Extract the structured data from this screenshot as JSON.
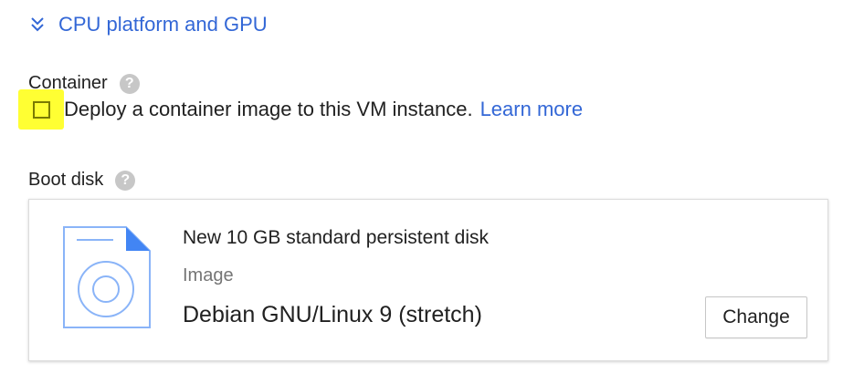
{
  "expander": {
    "label": "CPU platform and GPU",
    "icon": "double-chevron-down-icon"
  },
  "container": {
    "label": "Container",
    "help_icon": "?",
    "checkbox_checked": false,
    "checkbox_text": "Deploy a container image to this VM instance.",
    "learn_more": "Learn more"
  },
  "boot_disk": {
    "label": "Boot disk",
    "help_icon": "?",
    "title": "New 10 GB standard persistent disk",
    "image_label": "Image",
    "image_value": "Debian GNU/Linux 9 (stretch)",
    "change_label": "Change"
  },
  "colors": {
    "link": "#3367d6",
    "highlight": "#ffff33",
    "disk_icon": "#4285f4"
  }
}
